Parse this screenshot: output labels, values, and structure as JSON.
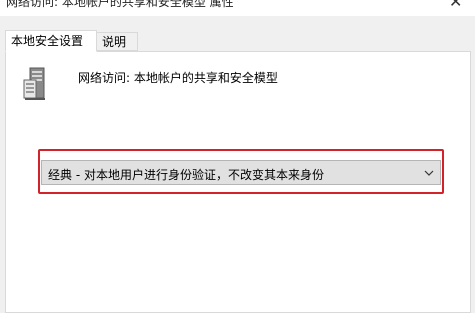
{
  "window": {
    "title": "网络访问: 本地帐户的共享和安全模型 属性",
    "close_glyph": "✕"
  },
  "tabs": [
    {
      "label": "本地安全设置",
      "active": true
    },
    {
      "label": "说明",
      "active": false
    }
  ],
  "policy": {
    "icon": "server-icon",
    "name": "网络访问: 本地帐户的共享和安全模型"
  },
  "dropdown": {
    "selected": "经典 - 对本地用户进行身份验证，不改变其本来身份",
    "icon": "chevron-down-icon"
  },
  "colors": {
    "highlight_border": "#d2232a",
    "panel_bg": "#ffffff",
    "window_bg": "#f0f0f0",
    "dropdown_bg": "#e1e1e1"
  }
}
